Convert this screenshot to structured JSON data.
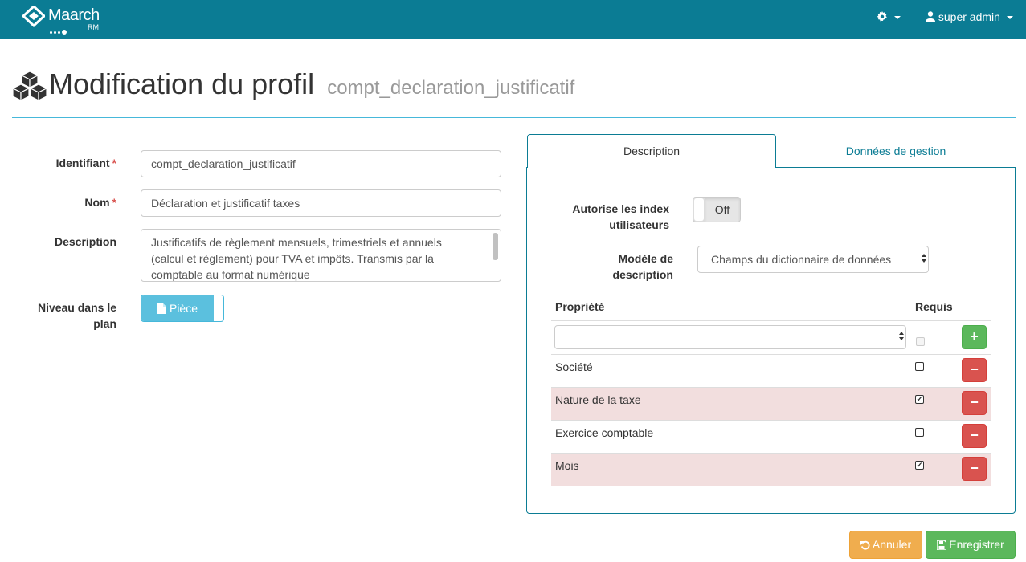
{
  "navbar": {
    "brand": "Maarch",
    "brand_sub": "RM",
    "settings_icon": "gear-icon",
    "user_label": "super admin",
    "user_icon": "user-icon"
  },
  "header": {
    "icon": "cubes-icon",
    "title": "Modification du profil",
    "subtitle": "compt_declaration_justificatif"
  },
  "form": {
    "identifier_label": "Identifiant",
    "identifier_value": "compt_declaration_justificatif",
    "name_label": "Nom",
    "name_value": "Déclaration et justificatif taxes",
    "required_mark": "*",
    "description_label": "Description",
    "description_value": "Justificatifs de règlement mensuels, trimestriels et annuels (calcul et règlement) pour TVA et impôts. Transmis par la comptable au format numérique",
    "level_label": "Niveau dans le plan",
    "level_value": "Pièce",
    "level_icon": "file-icon"
  },
  "tabs": [
    {
      "label": "Description",
      "active": true
    },
    {
      "label": "Données de gestion",
      "active": false
    }
  ],
  "description_tab": {
    "user_index_label": "Autorise les index utilisateurs",
    "user_index_value": "Off",
    "model_label": "Modèle de description",
    "model_value": "Champs du dictionnaire de données",
    "table": {
      "col_property": "Propriété",
      "col_required": "Requis",
      "new_property_value": "",
      "rows": [
        {
          "label": "Société",
          "required": false,
          "highlighted": false
        },
        {
          "label": "Nature de la taxe",
          "required": true,
          "highlighted": true
        },
        {
          "label": "Exercice comptable",
          "required": false,
          "highlighted": false
        },
        {
          "label": "Mois",
          "required": true,
          "highlighted": true
        }
      ]
    }
  },
  "actions": {
    "cancel_label": "Annuler",
    "cancel_icon": "undo-icon",
    "save_label": "Enregistrer",
    "save_icon": "floppy-icon"
  },
  "colors": {
    "navbar": "#0b7c94",
    "info": "#5bc0de",
    "success": "#5cb85c",
    "danger": "#d9534f",
    "warning": "#f0ad4e",
    "row_highlight": "#f2dede"
  }
}
